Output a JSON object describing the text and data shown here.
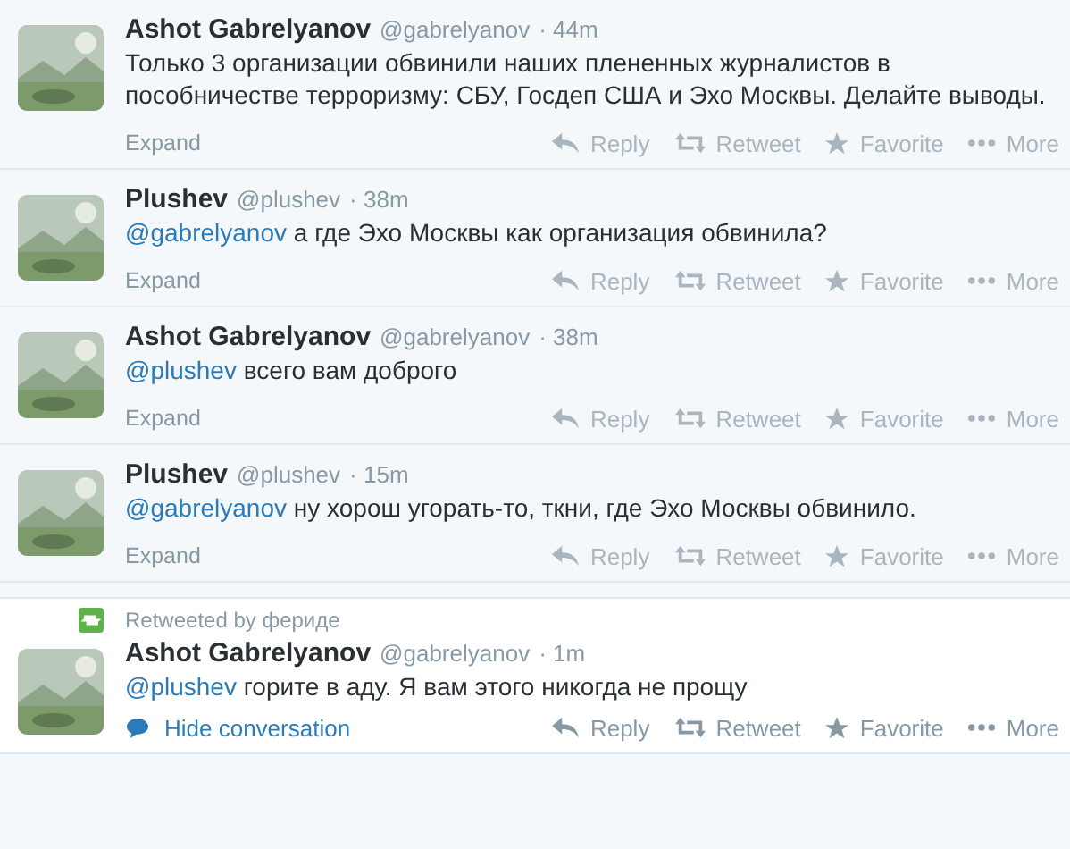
{
  "tweets": [
    {
      "name": "Ashot Gabrelyanov",
      "handle": "@gabrelyanov",
      "time": "· 44m",
      "text": "Только 3 организации обвинили наших плененных журналистов в пособничестве терроризму: СБУ, Госдеп США и Эхо Москвы. Делайте выводы.",
      "context": true,
      "footer": {
        "kind": "expand",
        "label": "Expand"
      },
      "actions": [
        "Reply",
        "Retweet",
        "Favorite",
        "More"
      ],
      "actions_faded": true
    },
    {
      "name": "Plushev",
      "handle": "@plushev",
      "time": "· 38m",
      "mention": "@gabrelyanov",
      "text": "а где Эхо Москвы как организация обвинила?",
      "context": true,
      "footer": {
        "kind": "expand",
        "label": "Expand"
      },
      "actions": [
        "Reply",
        "Retweet",
        "Favorite",
        "More"
      ],
      "actions_faded": true
    },
    {
      "name": "Ashot Gabrelyanov",
      "handle": "@gabrelyanov",
      "time": "· 38m",
      "mention": "@plushev",
      "text": "всего вам доброго",
      "context": true,
      "footer": {
        "kind": "expand",
        "label": "Expand"
      },
      "actions": [
        "Reply",
        "Retweet",
        "Favorite",
        "More"
      ],
      "actions_faded": true
    },
    {
      "name": "Plushev",
      "handle": "@plushev",
      "time": "· 15m",
      "mention": "@gabrelyanov",
      "text": "ну хорош угорать-то, ткни, где Эхо Москвы обвинило.",
      "context": true,
      "footer": {
        "kind": "expand",
        "label": "Expand"
      },
      "actions": [
        "Reply",
        "Retweet",
        "Favorite",
        "More"
      ],
      "actions_faded": true
    },
    {
      "retweeted_by": "Retweeted by фериде",
      "name": "Ashot Gabrelyanov",
      "handle": "@gabrelyanov",
      "time": "· 1m",
      "mention": "@plushev",
      "text": "горите в аду. Я вам этого никогда не прощу",
      "context": false,
      "footer": {
        "kind": "hide_conversation",
        "label": "Hide conversation"
      },
      "actions": [
        "Reply",
        "Retweet",
        "Favorite",
        "More"
      ],
      "actions_faded": false
    }
  ]
}
